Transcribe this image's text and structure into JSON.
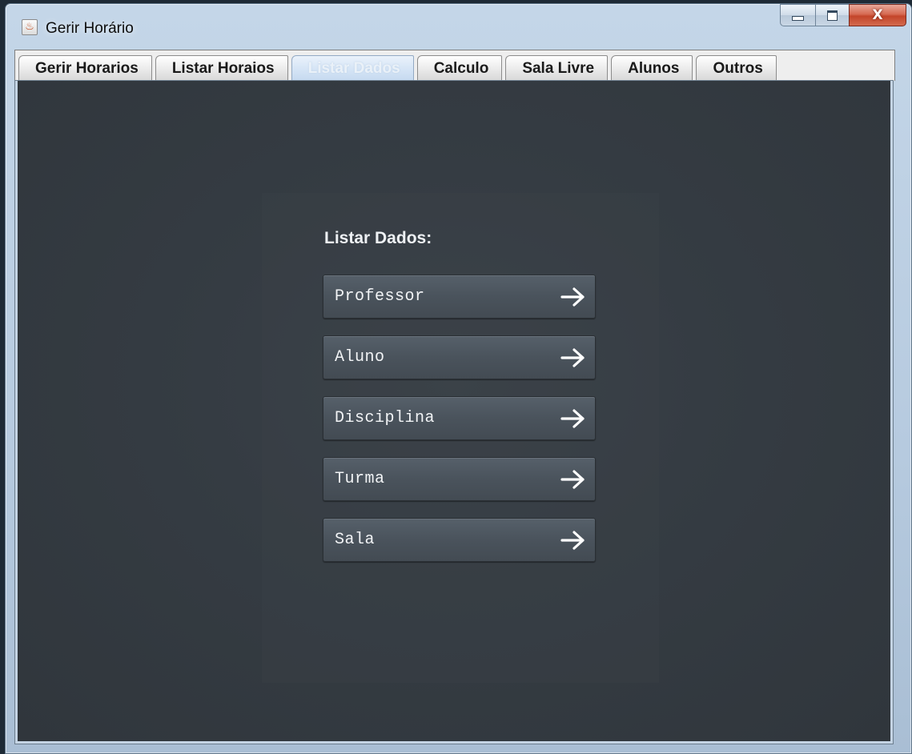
{
  "window": {
    "title": "Gerir Horário",
    "app_icon": "java-coffee-icon",
    "controls": {
      "minimize": "minimize-icon",
      "maximize": "maximize-icon",
      "close": "X"
    }
  },
  "tabs": [
    {
      "label": "Gerir Horarios",
      "active": false
    },
    {
      "label": "Listar Horaios",
      "active": false
    },
    {
      "label": "Listar Dados",
      "active": true
    },
    {
      "label": "Calculo",
      "active": false
    },
    {
      "label": "Sala Livre",
      "active": false
    },
    {
      "label": "Alunos",
      "active": false
    },
    {
      "label": "Outros",
      "active": false
    }
  ],
  "main": {
    "heading": "Listar Dados:",
    "buttons": [
      {
        "label": "Professor",
        "icon": "arrow-right-icon"
      },
      {
        "label": "Aluno",
        "icon": "arrow-right-icon"
      },
      {
        "label": "Disciplina",
        "icon": "arrow-right-icon"
      },
      {
        "label": "Turma",
        "icon": "arrow-right-icon"
      },
      {
        "label": "Sala",
        "icon": "arrow-right-icon"
      }
    ]
  },
  "colors": {
    "panel_bg": "#353c43",
    "button_bg": "#4a535c",
    "text_light": "#f2f4f6",
    "active_tab": "#d3e3f5"
  }
}
